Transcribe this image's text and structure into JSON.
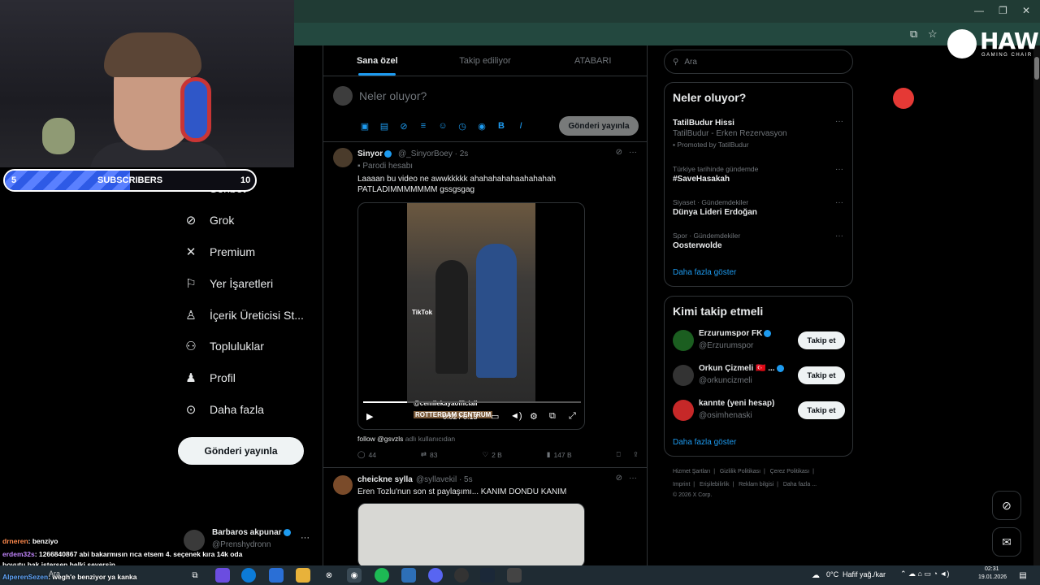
{
  "webcam": {
    "subscribers": {
      "left_value": "5",
      "label": "SUBSCRIBERS",
      "right_value": "10",
      "progress": 0.5
    }
  },
  "nav": {
    "items": [
      {
        "label": "Sohbet",
        "icon": "mail-icon"
      },
      {
        "label": "Grok",
        "icon": "grok-icon"
      },
      {
        "label": "Premium",
        "icon": "x-logo-icon"
      },
      {
        "label": "Yer İşaretleri",
        "icon": "bookmark-icon"
      },
      {
        "label": "İçerik Üreticisi St...",
        "icon": "creator-studio-icon"
      },
      {
        "label": "Topluluklar",
        "icon": "communities-icon"
      },
      {
        "label": "Profil",
        "icon": "profile-icon"
      },
      {
        "label": "Daha fazla",
        "icon": "more-icon"
      }
    ],
    "post_button": "Gönderi yayınla",
    "account": {
      "name": "Barbaros akpunar",
      "handle": "@Prenshydronn"
    }
  },
  "chat": [
    {
      "user": "drneren",
      "message": ": benziyo"
    },
    {
      "user": "erdem32s",
      "message": ": 1266840867 abi bakarmısın rıca etsem 4. seçenek kıra 14k oda"
    },
    {
      "user": "",
      "message": "boyutu bak istersen belki seversin"
    },
    {
      "user": "AlperenSezen",
      "message": ": wegh'e benziyor ya kanka"
    }
  ],
  "main": {
    "tabs": [
      "Sana özel",
      "Takip ediliyor",
      "ATABARI"
    ],
    "compose": {
      "placeholder": "Neler oluyor?",
      "publish": "Gönderi yayınla"
    },
    "tweets": [
      {
        "name": "Sinyor",
        "handle": "@_SinyorBoey",
        "time": "· 2s",
        "badge": "Parodi hesabı",
        "text_line1": "Laaaan bu video ne awwkkkkk ahahahahahaahahahah",
        "text_line2": "PATLADIMMMMMMM gssgsgag",
        "video": {
          "time": "0:02 / 0:13",
          "progress": 0.2,
          "overlay_user": "@cemilekayaofficiall",
          "overlay_tag": "ROTTERDAM CENTRUM",
          "tiktok_label": "TikTok"
        },
        "follow_line": "follow @gsvzls",
        "follow_suffix": "adlı kullanıcıdan",
        "replies": "44",
        "retweets": "83",
        "likes": "2 B",
        "views": "147 B"
      },
      {
        "name": "cheickne sylla",
        "handle": "@syllavekil",
        "time": "· 5s",
        "text_line1": "Eren Tozlu'nun son st paylaşımı... KANIM DONDU KANIM"
      }
    ]
  },
  "right": {
    "search_placeholder": "Ara",
    "trends_title": "Neler oluyor?",
    "trends": [
      {
        "small": "",
        "main": "TatilBudur Hissi",
        "sub": "TatilBudur - Erken Rezervasyon",
        "promo": "Promoted by TatilBudur"
      },
      {
        "small": "Türkiye tarihinde gündemde",
        "main": "#SaveHasakah"
      },
      {
        "small": "Siyaset · Gündemdekiler",
        "main": "Dünya Lideri Erdoğan"
      },
      {
        "small": "Spor · Gündemdekiler",
        "main": "Oosterwolde"
      }
    ],
    "trends_more": "Daha fazla göster",
    "who_title": "Kimi takip etmeli",
    "who": [
      {
        "name": "Erzurumspor FK",
        "handle": "@Erzurumspor",
        "button": "Takip et",
        "avatar_color": "#1b5e20"
      },
      {
        "name": "Orkun Çizmeli 🇹🇷 ...",
        "handle": "@orkuncizmeli",
        "button": "Takip et",
        "avatar_color": "#333"
      },
      {
        "name": "kannte (yeni hesap)",
        "handle": "@osimhenaski",
        "button": "Takip et",
        "avatar_color": "#c62828"
      }
    ],
    "who_more": "Daha fazla göster",
    "footer_line1": [
      "Hizmet Şartları",
      "|",
      "Gizlilik Politikası",
      "|",
      "Çerez Politikası",
      "|"
    ],
    "footer_line2": [
      "Imprint",
      "|",
      "Erişilebilirlik",
      "|",
      "Reklam bilgisi",
      "|",
      "Daha fazla ..."
    ],
    "footer_line3": "© 2026 X Corp."
  },
  "brand": {
    "name": "HAWK",
    "tagline": "GAMING CHAIR"
  },
  "taskbar": {
    "search": "Ara",
    "weather": "0°C",
    "weather_desc": "Hafif yağ./kar",
    "time": "02:31",
    "date": "19.01.2026"
  },
  "colors": {
    "accent": "#1d9bf0",
    "background": "#000000",
    "chrome": "#23483f"
  }
}
